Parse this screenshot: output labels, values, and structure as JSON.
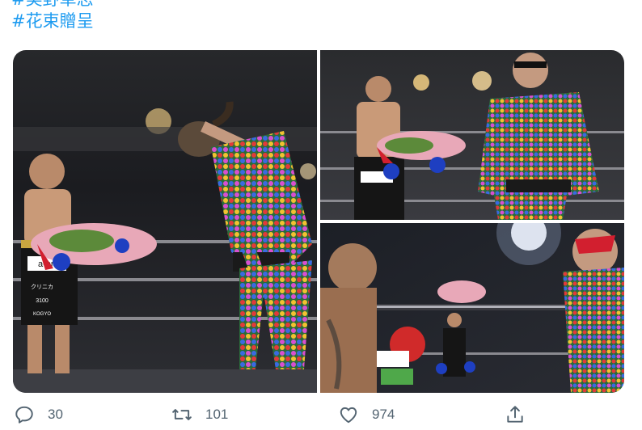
{
  "tweet": {
    "hashtags": [
      "#美野草志",
      "#花束贈呈"
    ]
  },
  "media": {
    "photos": [
      {
        "description_icon": "photo-icon"
      },
      {
        "description_icon": "photo-icon"
      },
      {
        "description_icon": "photo-icon"
      }
    ],
    "printed_text": {
      "trunks_brand": "a-on",
      "sponsor_1": "クリニカ",
      "sponsor_2": "3100",
      "sponsor_3": "KOGYO"
    }
  },
  "actions": {
    "reply": {
      "icon": "reply-icon",
      "count": "30"
    },
    "retweet": {
      "icon": "retweet-icon",
      "count": "101"
    },
    "like": {
      "icon": "heart-icon",
      "count": "974"
    },
    "share": {
      "icon": "share-icon"
    }
  },
  "colors": {
    "link": "#1d9bf0",
    "icon": "#536471"
  }
}
